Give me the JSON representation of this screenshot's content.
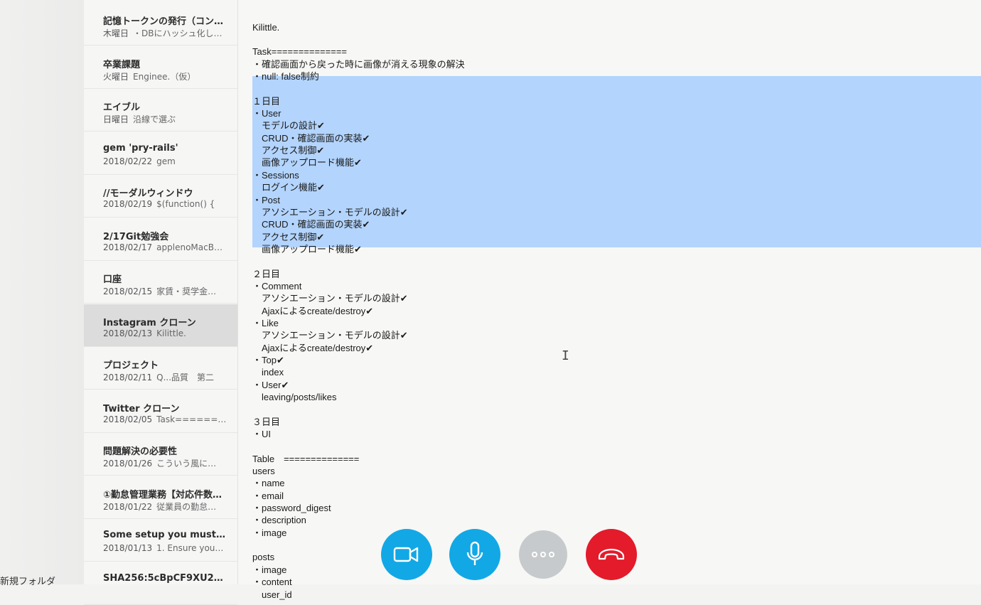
{
  "sidebar": {
    "new_folder_label": "新規フォルダ"
  },
  "notes": [
    {
      "title": "記憶トークンの発行（コン…",
      "date": "木曜日",
      "preview": "・DBにハッシュ化し…"
    },
    {
      "title": "卒業課題",
      "date": "火曜日",
      "preview": "Enginee.（仮）"
    },
    {
      "title": "エイブル",
      "date": "日曜日",
      "preview": "沿線で選ぶ"
    },
    {
      "title": "gem 'pry-rails'",
      "date": "2018/02/22",
      "preview": "gem"
    },
    {
      "title": "//モーダルウィンドウ",
      "date": "2018/02/19",
      "preview": "$(function() {"
    },
    {
      "title": "2/17Git勉強会",
      "date": "2018/02/17",
      "preview": "applenoMacB…"
    },
    {
      "title": "口座",
      "date": "2018/02/15",
      "preview": "家賃・奨学金…"
    },
    {
      "title": "Instagram クローン",
      "date": "2018/02/13",
      "preview": "Kilittle.",
      "selected": true
    },
    {
      "title": "プロジェクト",
      "date": "2018/02/11",
      "preview": "Q...品質　第二"
    },
    {
      "title": "Twitter クローン",
      "date": "2018/02/05",
      "preview": "Task======…"
    },
    {
      "title": "問題解決の必要性",
      "date": "2018/01/26",
      "preview": "こういう風に…"
    },
    {
      "title": "①勤怠管理業務【対応件数…",
      "date": "2018/01/22",
      "preview": "従業員の勤怠…"
    },
    {
      "title": "Some setup you must…",
      "date": "2018/01/13",
      "preview": "1. Ensure you…"
    },
    {
      "title": "SHA256:5cBpCF9XU2…",
      "date": "",
      "preview": ""
    }
  ],
  "editor": {
    "lines": [
      "",
      "",
      "Kilittle.",
      "",
      "Task==============",
      "・確認画面から戻った時に画像が消える現象の解決",
      "・null: false制約",
      "",
      "１日目",
      "・User",
      "　モデルの設計✔",
      "　CRUD・確認画面の実装✔",
      "　アクセス制御✔",
      "　画像アップロード機能✔",
      "・Sessions",
      "　ログイン機能✔",
      "・Post",
      "　アソシエーション・モデルの設計✔",
      "　CRUD・確認画面の実装✔",
      "　アクセス制御✔",
      "　画像アップロード機能✔",
      "",
      "２日目",
      "・Comment",
      "　アソシエーション・モデルの設計✔",
      "　Ajaxによるcreate/destroy✔",
      "・Like",
      "　アソシエーション・モデルの設計✔",
      "　Ajaxによるcreate/destroy✔",
      "・Top✔",
      "　index",
      "・User✔",
      "　leaving/posts/likes",
      "",
      "３日目",
      "・UI",
      "",
      "Table　==============",
      "users",
      "・name",
      "・email",
      "・password_digest",
      "・description",
      "・image",
      "",
      "posts",
      "・image",
      "・content",
      "　user_id"
    ]
  },
  "call_controls": [
    {
      "name": "video-button",
      "icon": "video-camera-icon",
      "color": "#12a8e6"
    },
    {
      "name": "mic-button",
      "icon": "microphone-icon",
      "color": "#12a8e6"
    },
    {
      "name": "more-button",
      "icon": "more-dots-icon",
      "color": "#c7cacc"
    },
    {
      "name": "hangup-button",
      "icon": "hang-up-phone-icon",
      "color": "#e31b2b"
    }
  ],
  "colors": {
    "selection": "#b3d4fc",
    "selected_note": "#dcdcdc"
  }
}
